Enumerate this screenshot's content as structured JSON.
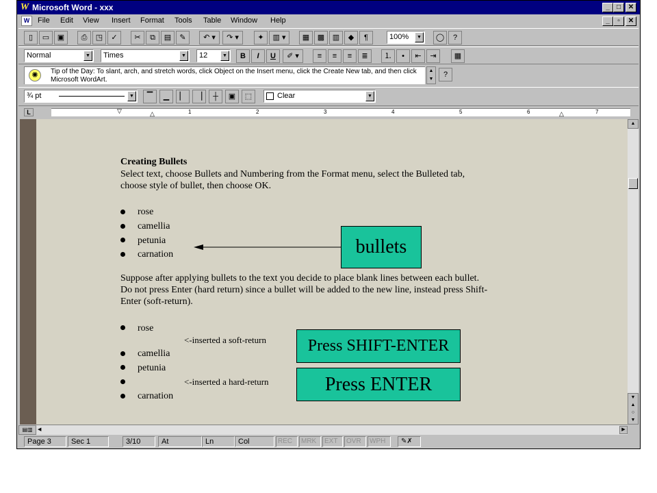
{
  "window": {
    "title": "Microsoft Word - xxx",
    "controls": [
      "_",
      "□",
      "✕"
    ]
  },
  "menu": [
    "File",
    "Edit",
    "View",
    "Insert",
    "Format",
    "Tools",
    "Table",
    "Window",
    "Help"
  ],
  "formatting": {
    "style": "Normal",
    "font": "Times",
    "size": "12",
    "bold": "B",
    "italic": "I",
    "underline": "U"
  },
  "standard": {
    "zoom": "100%"
  },
  "tip": {
    "text": "Tip of the Day: To slant, arch, and stretch words, click Object on the Insert menu, click the Create New tab, and then click Microsoft WordArt."
  },
  "borders": {
    "line_weight": "¾ pt",
    "shading": "Clear"
  },
  "ruler": {
    "numbers": [
      "1",
      "2",
      "3",
      "4",
      "5",
      "6",
      "7"
    ]
  },
  "document": {
    "heading": "Creating Bullets",
    "intro": [
      "Select text, choose Bullets and Numbering from the Format menu, select the Bulleted tab,",
      "choose style of bullet, then choose OK."
    ],
    "list1": [
      "rose",
      "camellia",
      "petunia",
      "carnation"
    ],
    "para2": [
      "Suppose after applying bullets to the text you decide to place blank lines between each bullet.",
      "Do not press Enter (hard return) since a bullet will be added to the new line, instead press Shift-",
      "Enter (soft-return)."
    ],
    "list2": [
      "rose",
      "camellia",
      "petunia",
      "carnation"
    ],
    "soft_note": "<-inserted a soft-return",
    "hard_note": "<-inserted a hard-return"
  },
  "callouts": {
    "bullets": "bullets",
    "shift_enter": "Press SHIFT-ENTER",
    "enter": "Press ENTER"
  },
  "status": {
    "page": "Page 3",
    "sec": "Sec 1",
    "pages": "3/10",
    "at": "At",
    "ln": "Ln",
    "col": "Col",
    "modes": [
      "REC",
      "MRK",
      "EXT",
      "OVR",
      "WPH"
    ]
  },
  "colors": {
    "titlebar": "#000080",
    "callout": "#19c39b",
    "document_bg": "#d6d3c5"
  }
}
